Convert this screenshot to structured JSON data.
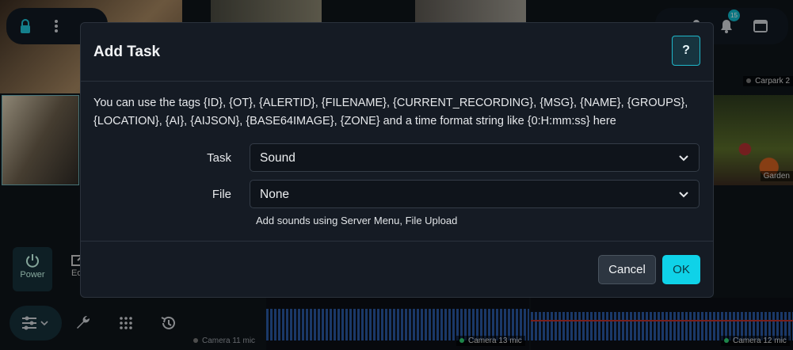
{
  "background": {
    "cameras": [
      {
        "label": "Carpark 2"
      },
      {
        "label": "Garden"
      },
      {
        "label": "Camera 11 mic"
      },
      {
        "label": "Camera 13 mic"
      },
      {
        "label": "Camera 12 mic"
      }
    ],
    "notification_count": "15",
    "sidebar": {
      "power_label": "Power",
      "edit_label": "Ed"
    },
    "icons": [
      "lock-icon",
      "more-vertical-icon",
      "user-icon",
      "bell-icon",
      "window-icon",
      "power-icon",
      "edit-icon",
      "tune-icon",
      "wrench-icon",
      "grid-icon",
      "history-icon"
    ]
  },
  "dialog": {
    "title": "Add Task",
    "help_label": "?",
    "description": "You can use the tags {ID}, {OT}, {ALERTID}, {FILENAME}, {CURRENT_RECORDING}, {MSG}, {NAME}, {GROUPS}, {LOCATION}, {AI}, {AIJSON}, {BASE64IMAGE}, {ZONE} and a time format string like {0:H:mm:ss} here",
    "task": {
      "label": "Task",
      "value": "Sound"
    },
    "file": {
      "label": "File",
      "value": "None",
      "hint": "Add sounds using Server Menu, File Upload"
    },
    "cancel_label": "Cancel",
    "ok_label": "OK"
  },
  "colors": {
    "accent": "#0fd2e8",
    "dialog_bg": "#151b24",
    "page_bg": "#0f141a"
  }
}
